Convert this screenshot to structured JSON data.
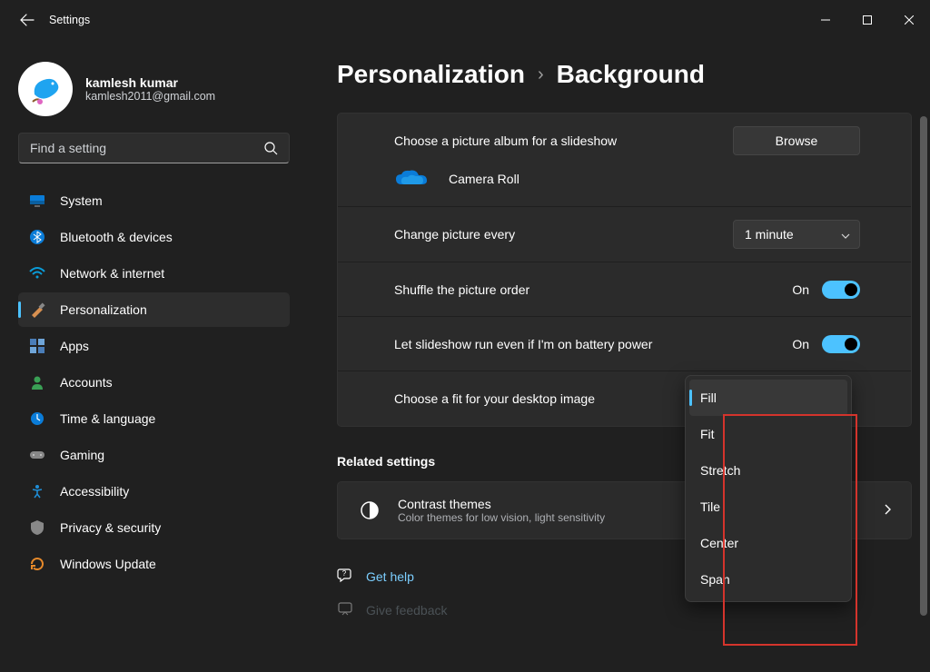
{
  "titlebar": {
    "title": "Settings"
  },
  "account": {
    "name": "kamlesh kumar",
    "email": "kamlesh2011@gmail.com"
  },
  "search": {
    "placeholder": "Find a setting"
  },
  "nav": {
    "items": [
      {
        "label": "System"
      },
      {
        "label": "Bluetooth & devices"
      },
      {
        "label": "Network & internet"
      },
      {
        "label": "Personalization"
      },
      {
        "label": "Apps"
      },
      {
        "label": "Accounts"
      },
      {
        "label": "Time & language"
      },
      {
        "label": "Gaming"
      },
      {
        "label": "Accessibility"
      },
      {
        "label": "Privacy & security"
      },
      {
        "label": "Windows Update"
      }
    ]
  },
  "breadcrumb": {
    "parent": "Personalization",
    "current": "Background"
  },
  "settings": {
    "choose_album_label": "Choose a picture album for a slideshow",
    "browse_label": "Browse",
    "album_name": "Camera Roll",
    "change_every_label": "Change picture every",
    "change_every_value": "1 minute",
    "shuffle_label": "Shuffle the picture order",
    "shuffle_value": "On",
    "battery_label": "Let slideshow run even if I'm on battery power",
    "battery_value": "On",
    "fit_label": "Choose a fit for your desktop image",
    "fit_options": [
      "Fill",
      "Fit",
      "Stretch",
      "Tile",
      "Center",
      "Span"
    ],
    "fit_selected": "Fill"
  },
  "related": {
    "heading": "Related settings",
    "contrast_title": "Contrast themes",
    "contrast_sub": "Color themes for low vision, light sensitivity"
  },
  "links": {
    "help": "Get help",
    "feedback": "Give feedback"
  },
  "colors": {
    "accent": "#4cc2ff"
  }
}
